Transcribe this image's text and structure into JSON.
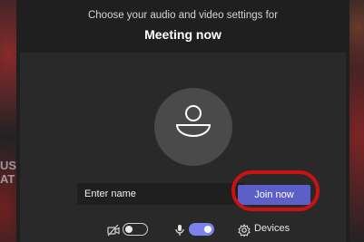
{
  "window": {
    "subtitle": "Choose your audio and video settings for",
    "title": "Meeting now"
  },
  "preview": {
    "avatar_icon": "person-icon"
  },
  "join_form": {
    "name_placeholder": "Enter name",
    "name_value": "",
    "join_label": "Join now",
    "join_highlight_color": "#cc1111"
  },
  "controls": {
    "camera": {
      "icon": "camera-off-icon",
      "enabled": false
    },
    "microphone": {
      "icon": "microphone-icon",
      "enabled": true
    },
    "devices": {
      "icon": "gear-icon",
      "label": "Devices"
    },
    "accent_color": "#7b83eb"
  },
  "colors": {
    "join_button": "#5b5fc7",
    "panel": "#1f1f1f",
    "preview": "#292929"
  }
}
